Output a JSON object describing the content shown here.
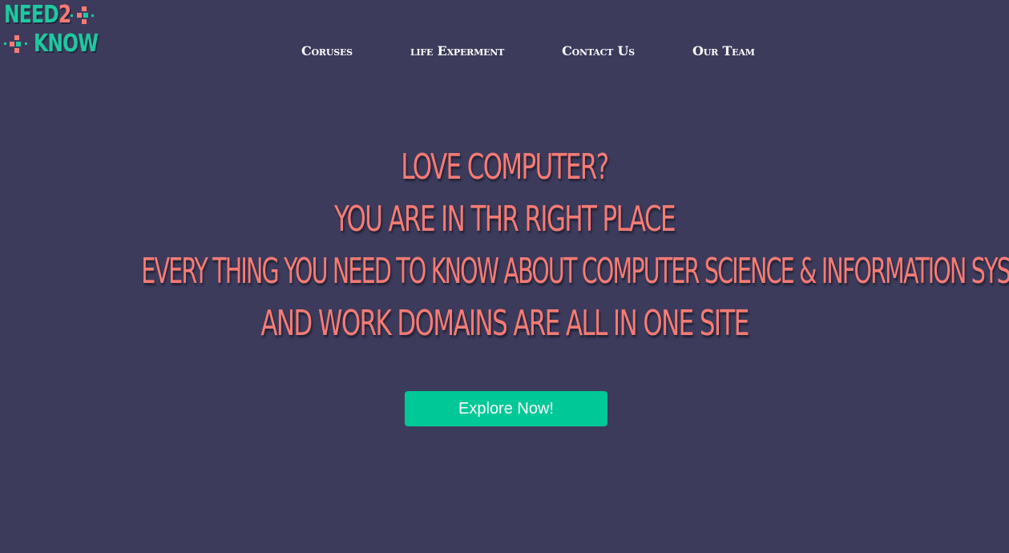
{
  "logo": {
    "line1_prefix": "NEED",
    "line1_suffix": "2",
    "line2": "KNOW",
    "colors": {
      "primary": "#1ec9a0",
      "accent": "#f77b74"
    }
  },
  "nav": {
    "items": [
      {
        "label": "Coruses"
      },
      {
        "label": "life Experment"
      },
      {
        "label": "Contact Us"
      },
      {
        "label": "Our Team"
      }
    ]
  },
  "hero": {
    "lines": [
      "LOVE COMPUTER?",
      "YOU ARE IN THR RIGHT PLACE",
      "EVERY THING YOU NEED TO KNOW ABOUT COMPUTER SCIENCE & INFORMATION SYSTEM",
      "AND WORK DOMAINS ARE ALL IN ONE SITE"
    ],
    "color": "#f77b74"
  },
  "cta": {
    "label": "Explore Now!",
    "color": "#00c896"
  },
  "theme": {
    "background": "#3c3b5c"
  }
}
